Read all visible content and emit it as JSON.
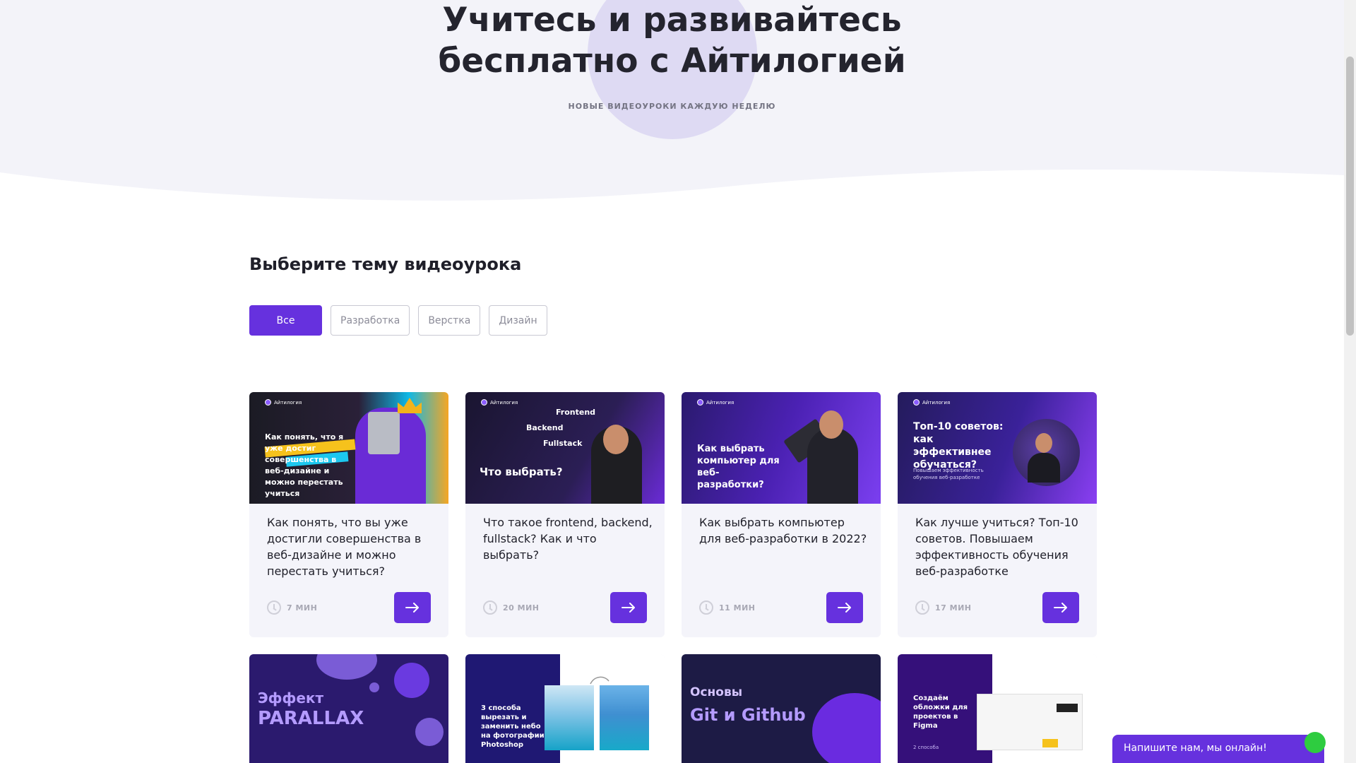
{
  "hero": {
    "title_line1": "Учитесь и развивайтесь",
    "title_line2": "бесплатно с Айтилогией",
    "subtitle": "НОВЫЕ ВИДЕОУРОКИ КАЖДУЮ НЕДЕЛЮ"
  },
  "section_title": "Выберите тему видеоурока",
  "filters": [
    {
      "label": "Все",
      "active": true
    },
    {
      "label": "Разработка",
      "active": false
    },
    {
      "label": "Верстка",
      "active": false
    },
    {
      "label": "Дизайн",
      "active": false
    }
  ],
  "cards": [
    {
      "thumb_brand": "Айтилогия",
      "thumb_text": "Как понять, что я уже достиг совершенства в веб-дизайне и можно перестать учиться",
      "title": "Как понять, что вы уже достигли совершенства в веб-дизайне и можно перестать учиться?",
      "time": "7 МИН"
    },
    {
      "thumb_brand": "Айтилогия",
      "thumb_words": [
        "Frontend",
        "Backend",
        "Fullstack"
      ],
      "thumb_text": "Что выбрать?",
      "title": "Что такое frontend, backend, fullstack? Как и что выбрать?",
      "time": "20 МИН"
    },
    {
      "thumb_brand": "Айтилогия",
      "thumb_text": "Как выбрать компьютер для веб-разработки?",
      "title": "Как выбрать компьютер для веб-разработки в 2022?",
      "time": "11 МИН"
    },
    {
      "thumb_brand": "Айтилогия",
      "thumb_text": "Топ-10 советов: как эффективнее обучаться?",
      "thumb_small": "Повышаем эффективность обучения веб-разработке",
      "title": "Как лучше учиться? Топ-10 советов. Повышаем эффективность обучения веб-разработке",
      "time": "17 МИН"
    }
  ],
  "cards_row2": [
    {
      "thumb_text": "Эффект",
      "thumb_text2": "PARALLAX"
    },
    {
      "thumb_text": "3 способа вырезать и заменить небо на фотографии в Photoshop"
    },
    {
      "thumb_text": "Основы",
      "thumb_text2": "Git и Github"
    },
    {
      "thumb_text": "Создаём обложки для проектов в Figma",
      "thumb_small": "2 способа"
    }
  ],
  "chat": {
    "label": "Напишите нам, мы онлайн!"
  },
  "colors": {
    "accent": "#6631de",
    "hero_bg": "#f3f3f9",
    "card_bg": "#f4f4fa"
  },
  "icons": {
    "time": "clock-icon",
    "go": "arrow-right-icon"
  }
}
